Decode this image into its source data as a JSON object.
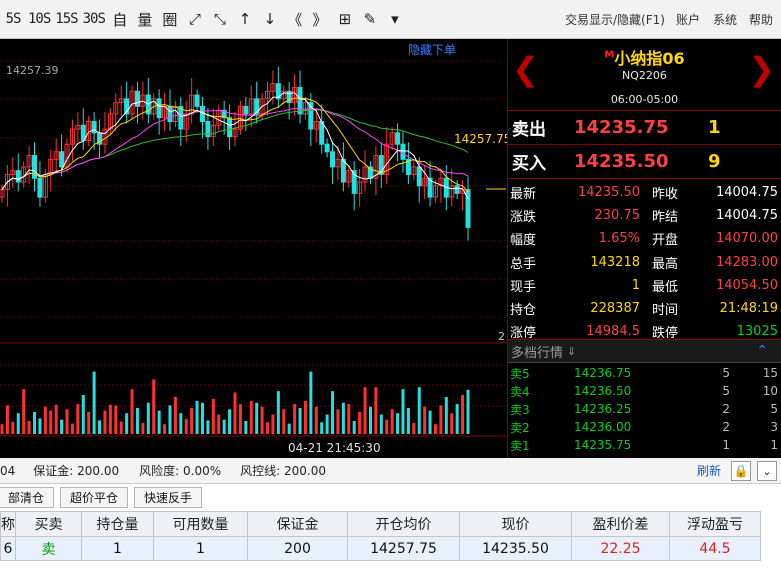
{
  "toolbar": {
    "tools": [
      {
        "name": "interval-5s-button",
        "label": "5S",
        "txt": true
      },
      {
        "name": "interval-10s-button",
        "label": "10S",
        "txt": true
      },
      {
        "name": "interval-15s-button",
        "label": "15S",
        "txt": true
      },
      {
        "name": "interval-30s-button",
        "label": "30S",
        "txt": true
      },
      {
        "name": "custom-button",
        "label": "自",
        "txt": false
      },
      {
        "name": "volume-button",
        "label": "量",
        "txt": false
      },
      {
        "name": "grid-button",
        "label": "圈",
        "txt": false
      },
      {
        "name": "expand-icon",
        "label": "⤢",
        "txt": false
      },
      {
        "name": "collapse-icon",
        "label": "⤡",
        "txt": false
      },
      {
        "name": "arrow-up-icon",
        "label": "↑",
        "txt": false
      },
      {
        "name": "arrow-down-icon",
        "label": "↓",
        "txt": false
      },
      {
        "name": "double-left-icon",
        "label": "《",
        "txt": false
      },
      {
        "name": "double-right-icon",
        "label": "》",
        "txt": false
      },
      {
        "name": "layout-grid-icon",
        "label": "⊞",
        "txt": false
      },
      {
        "name": "pen-icon",
        "label": "✎",
        "txt": false
      },
      {
        "name": "dropdown-icon",
        "label": "▾",
        "txt": false
      }
    ],
    "trade_toggle": "交易显示/隐藏(F1)",
    "account": "账户",
    "system": "系统",
    "help": "帮助"
  },
  "chart": {
    "price_top": "14257.39",
    "hide_order_label": "隐藏下单",
    "avg_price_label": "14257.75",
    "right_axis_2": "2",
    "time_label": "04-21 21:45:30"
  },
  "chart_data": {
    "type": "line",
    "title": "小纳指06",
    "series": [
      {
        "values": [
          14246,
          14250,
          14251,
          14248,
          14252,
          14255,
          14249,
          14244,
          14250,
          14254,
          14256,
          14252,
          14258,
          14262,
          14263,
          14259,
          14264,
          14261,
          14258,
          14262,
          14266,
          14269,
          14270,
          14266,
          14272,
          14268,
          14271,
          14266,
          14270,
          14265,
          14268,
          14264,
          14268,
          14262,
          14266,
          14271,
          14268,
          14264,
          14260,
          14263,
          14267,
          14265,
          14260,
          14262,
          14268,
          14266,
          14270,
          14266,
          14270,
          14272,
          14274,
          14270,
          14272,
          14269,
          14273,
          14266,
          14269,
          14262,
          14264,
          14258,
          14256,
          14252,
          14254,
          14248,
          14251,
          14245,
          14248,
          14252,
          14249,
          14255,
          14250,
          14258,
          14261,
          14258,
          14254,
          14250,
          14252,
          14247,
          14249,
          14244,
          14247,
          14249,
          14244,
          14247,
          14245,
          14246,
          14236
        ]
      }
    ],
    "volume": [
      1,
      2,
      1,
      2,
      3,
      1,
      2,
      1,
      2,
      2,
      3,
      1,
      2,
      1,
      2,
      3,
      2,
      4,
      1,
      2,
      3,
      2,
      1,
      2,
      3,
      2,
      1,
      2,
      4,
      2,
      1,
      2,
      3,
      2,
      1,
      2,
      3,
      2,
      1,
      3,
      2,
      1,
      2,
      4,
      2,
      1,
      3,
      2,
      2,
      1,
      2,
      3,
      2,
      1,
      2,
      2,
      3,
      4,
      2,
      1,
      2,
      3,
      2,
      3,
      2,
      1,
      2,
      3,
      2,
      4,
      2,
      1,
      2,
      2,
      3,
      2,
      1,
      3,
      2,
      2,
      1,
      2,
      3,
      2,
      2,
      3,
      4
    ],
    "ylim": [
      14225,
      14280
    ]
  },
  "quote": {
    "name_sup": "M",
    "name": "小纳指06",
    "code": "NQ2206",
    "session": "06:00-05:00",
    "sell_label": "卖出",
    "sell_price": "14235.75",
    "sell_vol": "1",
    "buy_label": "买入",
    "buy_price": "14235.50",
    "buy_vol": "9",
    "stats": [
      {
        "l1": "最新",
        "v1": "14235.50",
        "c1": "#ff4040",
        "l2": "昨收",
        "v2": "14004.75",
        "c2": "#ffffff"
      },
      {
        "l1": "涨跌",
        "v1": "230.75",
        "c1": "#ff4040",
        "l2": "昨结",
        "v2": "14004.75",
        "c2": "#ffffff"
      },
      {
        "l1": "幅度",
        "v1": "1.65%",
        "c1": "#ff4040",
        "l2": "开盘",
        "v2": "14070.00",
        "c2": "#ff4040"
      },
      {
        "l1": "总手",
        "v1": "143218",
        "c1": "#ffd800",
        "l2": "最高",
        "v2": "14283.00",
        "c2": "#ff4040"
      },
      {
        "l1": "现手",
        "v1": "1",
        "c1": "#ffd800",
        "l2": "最低",
        "v2": "14054.50",
        "c2": "#ff4040"
      },
      {
        "l1": "持仓",
        "v1": "228387",
        "c1": "#ffd800",
        "l2": "时间",
        "v2": "21:48:19",
        "c2": "#ffd800"
      },
      {
        "l1": "涨停",
        "v1": "14984.5",
        "c1": "#ff4040",
        "l2": "跌停",
        "v2": "13025",
        "c2": "#00d020"
      }
    ],
    "depth_title": "多档行情",
    "depth": [
      {
        "label": "卖5",
        "price": "14236.75",
        "v1": "5",
        "v2": "15"
      },
      {
        "label": "卖4",
        "price": "14236.50",
        "v1": "5",
        "v2": "10"
      },
      {
        "label": "卖3",
        "price": "14236.25",
        "v1": "2",
        "v2": "5"
      },
      {
        "label": "卖2",
        "price": "14236.00",
        "v1": "2",
        "v2": "3"
      },
      {
        "label": "卖1",
        "price": "14235.75",
        "v1": "1",
        "v2": "1"
      }
    ]
  },
  "account": {
    "partial": "04",
    "margin": "保证金: 200.00",
    "risk": "风险度: 0.00%",
    "control": "风控线: 200.00",
    "refresh": "刷新"
  },
  "buttons": {
    "close_all": "部清仓",
    "super_close": "超价平仓",
    "quick_reverse": "快速反手"
  },
  "positions": {
    "headers": [
      "称",
      "买卖",
      "持仓量",
      "可用数量",
      "保证金",
      "开仓均价",
      "现价",
      "盈利价差",
      "浮动盈亏"
    ],
    "row": [
      "6",
      "卖",
      "1",
      "1",
      "200",
      "14257.75",
      "14235.50",
      "22.25",
      "44.5"
    ]
  },
  "colors": {
    "up": "#ff4040",
    "down": "#00d020",
    "accent": "#ffd800"
  }
}
